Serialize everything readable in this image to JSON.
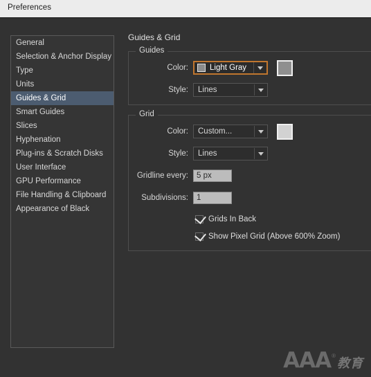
{
  "window": {
    "title": "Preferences"
  },
  "sidebar": {
    "items": [
      {
        "label": "General",
        "selected": false
      },
      {
        "label": "Selection & Anchor Display",
        "selected": false
      },
      {
        "label": "Type",
        "selected": false
      },
      {
        "label": "Units",
        "selected": false
      },
      {
        "label": "Guides & Grid",
        "selected": true
      },
      {
        "label": "Smart Guides",
        "selected": false
      },
      {
        "label": "Slices",
        "selected": false
      },
      {
        "label": "Hyphenation",
        "selected": false
      },
      {
        "label": "Plug-ins & Scratch Disks",
        "selected": false
      },
      {
        "label": "User Interface",
        "selected": false
      },
      {
        "label": "GPU Performance",
        "selected": false
      },
      {
        "label": "File Handling & Clipboard",
        "selected": false
      },
      {
        "label": "Appearance of Black",
        "selected": false
      }
    ]
  },
  "pane": {
    "title": "Guides & Grid",
    "guides": {
      "legend": "Guides",
      "color_label": "Color:",
      "color_value": "Light Gray",
      "color_swatch_hex": "#8c8c8c",
      "color_button_hex": "#8f8f8f",
      "style_label": "Style:",
      "style_value": "Lines"
    },
    "grid": {
      "legend": "Grid",
      "color_label": "Color:",
      "color_value": "Custom...",
      "color_button_hex": "#d2d2d2",
      "style_label": "Style:",
      "style_value": "Lines",
      "gridline_label": "Gridline every:",
      "gridline_value": "5 px",
      "subdivisions_label": "Subdivisions:",
      "subdivisions_value": "1",
      "grids_in_back_label": "Grids In Back",
      "grids_in_back_checked": true,
      "show_pixel_grid_label": "Show Pixel Grid (Above 600% Zoom)",
      "show_pixel_grid_checked": true
    }
  },
  "watermark": {
    "brand": "AAA",
    "registered": "®",
    "suffix": "教育"
  },
  "theme": {
    "background": "#323232",
    "titlebar": "#ececec",
    "selection": "#4c5c70",
    "focus_accent": "#c1762e"
  }
}
